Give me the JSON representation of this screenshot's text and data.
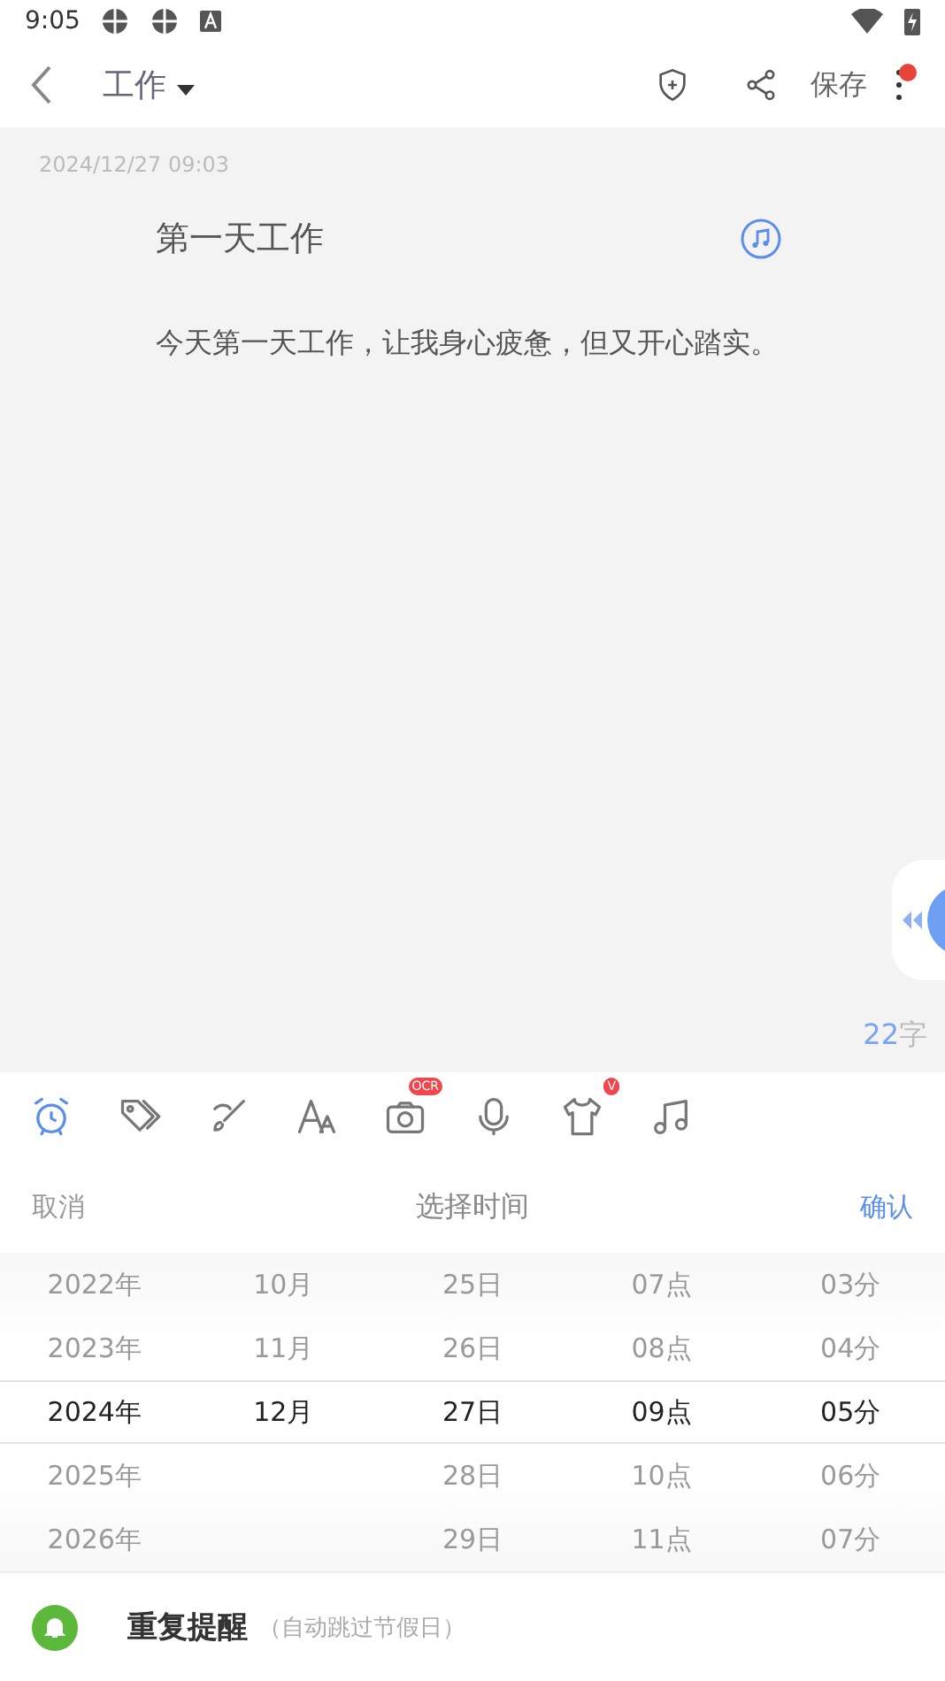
{
  "status_bar": {
    "time": "9:05"
  },
  "header": {
    "folder": "工作",
    "save": "保存",
    "notification_dot": true
  },
  "note": {
    "date": "2024/12/27 09:03",
    "title": "第一天工作",
    "body": "今天第一天工作，让我身心疲惫，但又开心踏实。",
    "count": "22",
    "count_unit": "字"
  },
  "toolbar": [
    {
      "kind": "alarm",
      "selected": true
    },
    {
      "kind": "tag",
      "selected": false
    },
    {
      "kind": "brush",
      "selected": false
    },
    {
      "kind": "font",
      "selected": false
    },
    {
      "kind": "camera",
      "selected": false,
      "badge": "OCR"
    },
    {
      "kind": "mic",
      "selected": false
    },
    {
      "kind": "shirt",
      "selected": false,
      "badge": "V"
    },
    {
      "kind": "music",
      "selected": false
    }
  ],
  "picker": {
    "cancel": "取消",
    "title": "选择时间",
    "confirm": "确认",
    "columns": [
      {
        "items": [
          {
            "label": "2022年",
            "selected": false
          },
          {
            "label": "2023年",
            "selected": false
          },
          {
            "label": "2024年",
            "selected": true
          },
          {
            "label": "2025年",
            "selected": false
          },
          {
            "label": "2026年",
            "selected": false
          }
        ]
      },
      {
        "items": [
          {
            "label": "10月",
            "selected": false
          },
          {
            "label": "11月",
            "selected": false
          },
          {
            "label": "12月",
            "selected": true
          }
        ]
      },
      {
        "items": [
          {
            "label": "25日",
            "selected": false
          },
          {
            "label": "26日",
            "selected": false
          },
          {
            "label": "27日",
            "selected": true
          },
          {
            "label": "28日",
            "selected": false
          },
          {
            "label": "29日",
            "selected": false
          }
        ]
      },
      {
        "items": [
          {
            "label": "07点",
            "selected": false
          },
          {
            "label": "08点",
            "selected": false
          },
          {
            "label": "09点",
            "selected": true
          },
          {
            "label": "10点",
            "selected": false
          },
          {
            "label": "11点",
            "selected": false
          }
        ]
      },
      {
        "items": [
          {
            "label": "03分",
            "selected": false
          },
          {
            "label": "04分",
            "selected": false
          },
          {
            "label": "05分",
            "selected": true
          },
          {
            "label": "06分",
            "selected": false
          },
          {
            "label": "07分",
            "selected": false
          }
        ]
      }
    ]
  },
  "repeat": {
    "label": "重复提醒",
    "hint": "（自动跳过节假日）"
  }
}
